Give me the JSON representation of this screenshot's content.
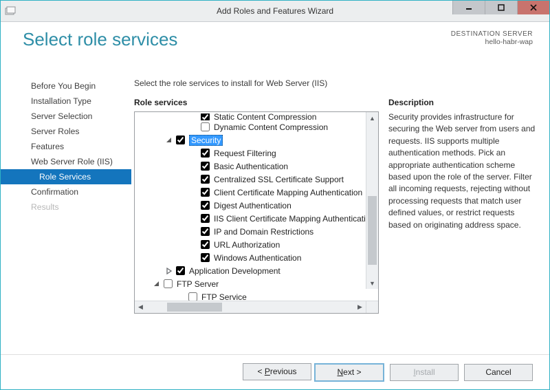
{
  "window": {
    "title": "Add Roles and Features Wizard"
  },
  "header": {
    "page_title": "Select role services",
    "dest_label": "DESTINATION SERVER",
    "dest_server": "hello-habr-wap"
  },
  "nav": {
    "items": [
      {
        "label": "Before You Begin"
      },
      {
        "label": "Installation Type"
      },
      {
        "label": "Server Selection"
      },
      {
        "label": "Server Roles"
      },
      {
        "label": "Features"
      },
      {
        "label": "Web Server Role (IIS)"
      },
      {
        "label": "Role Services",
        "selected": true,
        "sub": true
      },
      {
        "label": "Confirmation"
      },
      {
        "label": "Results",
        "disabled": true
      }
    ]
  },
  "content": {
    "instruction": "Select the role services to install for Web Server (IIS)",
    "roles_title": "Role services",
    "desc_title": "Description",
    "desc_text": "Security provides infrastructure for securing the Web server from users and requests. IIS supports multiple authentication methods. Pick an appropriate authentication scheme based upon the role of the server. Filter all incoming requests, rejecting without processing requests that match user defined values, or restrict requests based on originating address space."
  },
  "tree": [
    {
      "indent": 80,
      "checked": true,
      "label": "Static Content Compression",
      "partial": true
    },
    {
      "indent": 80,
      "checked": false,
      "label": "Dynamic Content Compression"
    },
    {
      "indent": 44,
      "expander": "open",
      "checked": true,
      "label": "Security",
      "selected": true
    },
    {
      "indent": 80,
      "checked": true,
      "label": "Request Filtering"
    },
    {
      "indent": 80,
      "checked": true,
      "label": "Basic Authentication"
    },
    {
      "indent": 80,
      "checked": true,
      "label": "Centralized SSL Certificate Support"
    },
    {
      "indent": 80,
      "checked": true,
      "label": "Client Certificate Mapping Authentication"
    },
    {
      "indent": 80,
      "checked": true,
      "label": "Digest Authentication"
    },
    {
      "indent": 80,
      "checked": true,
      "label": "IIS Client Certificate Mapping Authentication"
    },
    {
      "indent": 80,
      "checked": true,
      "label": "IP and Domain Restrictions"
    },
    {
      "indent": 80,
      "checked": true,
      "label": "URL Authorization"
    },
    {
      "indent": 80,
      "checked": true,
      "label": "Windows Authentication"
    },
    {
      "indent": 44,
      "expander": "closed",
      "checked": true,
      "label": "Application Development"
    },
    {
      "indent": 26,
      "expander": "open",
      "checked": false,
      "label": "FTP Server"
    },
    {
      "indent": 62,
      "checked": false,
      "label": "FTP Service"
    }
  ],
  "footer": {
    "previous": "Previous",
    "next": "Next",
    "install": "Install",
    "cancel": "Cancel"
  }
}
